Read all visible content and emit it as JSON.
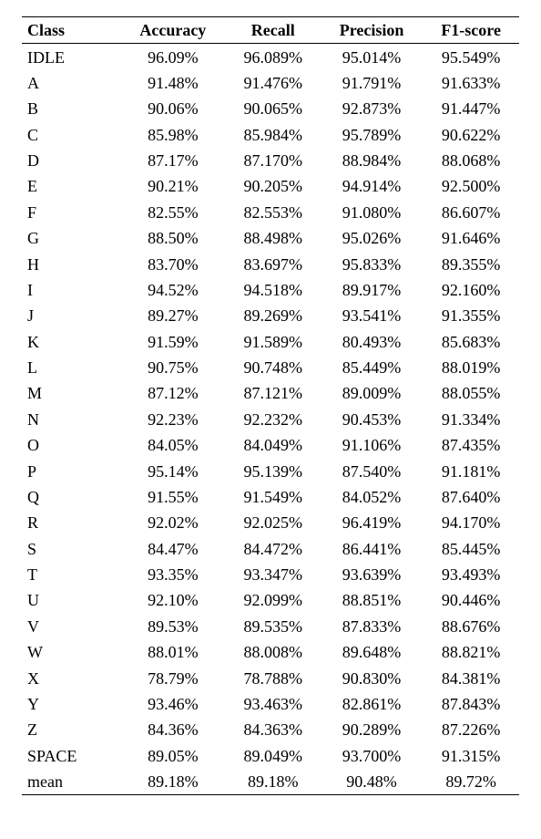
{
  "table": {
    "headers": {
      "class": "Class",
      "accuracy": "Accuracy",
      "recall": "Recall",
      "precision": "Precision",
      "f1": "F1-score"
    },
    "rows": [
      {
        "class": "IDLE",
        "accuracy": "96.09%",
        "recall": "96.089%",
        "precision": "95.014%",
        "f1": "95.549%"
      },
      {
        "class": "A",
        "accuracy": "91.48%",
        "recall": "91.476%",
        "precision": "91.791%",
        "f1": "91.633%"
      },
      {
        "class": "B",
        "accuracy": "90.06%",
        "recall": "90.065%",
        "precision": "92.873%",
        "f1": "91.447%"
      },
      {
        "class": "C",
        "accuracy": "85.98%",
        "recall": "85.984%",
        "precision": "95.789%",
        "f1": "90.622%"
      },
      {
        "class": "D",
        "accuracy": "87.17%",
        "recall": "87.170%",
        "precision": "88.984%",
        "f1": "88.068%"
      },
      {
        "class": "E",
        "accuracy": "90.21%",
        "recall": "90.205%",
        "precision": "94.914%",
        "f1": "92.500%"
      },
      {
        "class": "F",
        "accuracy": "82.55%",
        "recall": "82.553%",
        "precision": "91.080%",
        "f1": "86.607%"
      },
      {
        "class": "G",
        "accuracy": "88.50%",
        "recall": "88.498%",
        "precision": "95.026%",
        "f1": "91.646%"
      },
      {
        "class": "H",
        "accuracy": "83.70%",
        "recall": "83.697%",
        "precision": "95.833%",
        "f1": "89.355%"
      },
      {
        "class": "I",
        "accuracy": "94.52%",
        "recall": "94.518%",
        "precision": "89.917%",
        "f1": "92.160%"
      },
      {
        "class": "J",
        "accuracy": "89.27%",
        "recall": "89.269%",
        "precision": "93.541%",
        "f1": "91.355%"
      },
      {
        "class": "K",
        "accuracy": "91.59%",
        "recall": "91.589%",
        "precision": "80.493%",
        "f1": "85.683%"
      },
      {
        "class": "L",
        "accuracy": "90.75%",
        "recall": "90.748%",
        "precision": "85.449%",
        "f1": "88.019%"
      },
      {
        "class": "M",
        "accuracy": "87.12%",
        "recall": "87.121%",
        "precision": "89.009%",
        "f1": "88.055%"
      },
      {
        "class": "N",
        "accuracy": "92.23%",
        "recall": "92.232%",
        "precision": "90.453%",
        "f1": "91.334%"
      },
      {
        "class": "O",
        "accuracy": "84.05%",
        "recall": "84.049%",
        "precision": "91.106%",
        "f1": "87.435%"
      },
      {
        "class": "P",
        "accuracy": "95.14%",
        "recall": "95.139%",
        "precision": "87.540%",
        "f1": "91.181%"
      },
      {
        "class": "Q",
        "accuracy": "91.55%",
        "recall": "91.549%",
        "precision": "84.052%",
        "f1": "87.640%"
      },
      {
        "class": "R",
        "accuracy": "92.02%",
        "recall": "92.025%",
        "precision": "96.419%",
        "f1": "94.170%"
      },
      {
        "class": "S",
        "accuracy": "84.47%",
        "recall": "84.472%",
        "precision": "86.441%",
        "f1": "85.445%"
      },
      {
        "class": "T",
        "accuracy": "93.35%",
        "recall": "93.347%",
        "precision": "93.639%",
        "f1": "93.493%"
      },
      {
        "class": "U",
        "accuracy": "92.10%",
        "recall": "92.099%",
        "precision": "88.851%",
        "f1": "90.446%"
      },
      {
        "class": "V",
        "accuracy": "89.53%",
        "recall": "89.535%",
        "precision": "87.833%",
        "f1": "88.676%"
      },
      {
        "class": "W",
        "accuracy": "88.01%",
        "recall": "88.008%",
        "precision": "89.648%",
        "f1": "88.821%"
      },
      {
        "class": "X",
        "accuracy": "78.79%",
        "recall": "78.788%",
        "precision": "90.830%",
        "f1": "84.381%"
      },
      {
        "class": "Y",
        "accuracy": "93.46%",
        "recall": "93.463%",
        "precision": "82.861%",
        "f1": "87.843%"
      },
      {
        "class": "Z",
        "accuracy": "84.36%",
        "recall": "84.363%",
        "precision": "90.289%",
        "f1": "87.226%"
      },
      {
        "class": "SPACE",
        "accuracy": "89.05%",
        "recall": "89.049%",
        "precision": "93.700%",
        "f1": "91.315%"
      }
    ],
    "mean": {
      "class": "mean",
      "accuracy": "89.18%",
      "recall": "89.18%",
      "precision": "90.48%",
      "f1": "89.72%"
    }
  }
}
